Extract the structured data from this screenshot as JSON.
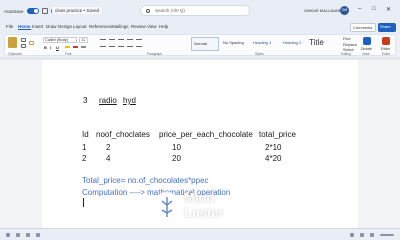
{
  "window": {
    "autosave_label": "AutoSave",
    "autosave_state": "on",
    "file_name": "class practice • Saved",
    "search_placeholder": "Search (Alt+Q)",
    "user_name": "OMKAR MALLAVARU",
    "user_initials": "OM",
    "accent_color": "#1f5fbf"
  },
  "menu": {
    "tabs": [
      "File",
      "Home",
      "Insert",
      "Draw",
      "Design",
      "Layout",
      "References",
      "Mailings",
      "Review",
      "View",
      "Help"
    ],
    "active_tab": "Home",
    "comments_label": "Comments",
    "share_label": "Share"
  },
  "ribbon": {
    "font_name": "Calibri (Body)",
    "font_size": "11",
    "format_buttons": [
      "B",
      "I",
      "U"
    ],
    "styles": [
      "Normal",
      "No Spacing",
      "Heading 1",
      "Heading 2",
      "Title"
    ],
    "find_label": "Find",
    "replace_label": "Replace",
    "select_label": "Select",
    "dictate_label": "Dictate",
    "editor_label": "Editor",
    "groups": [
      "Clipboard",
      "Font",
      "Paragraph",
      "Styles",
      "Editing",
      "Voice",
      "Editor"
    ]
  },
  "document": {
    "line1": [
      "3",
      "radio",
      "hyd"
    ],
    "table_headers": [
      "Id",
      "noof_choclates",
      "price_per_each_chocolate",
      "total_price"
    ],
    "rows": [
      [
        "1",
        "2",
        "10",
        "2*10"
      ],
      [
        "2",
        "4",
        "20",
        "4*20"
      ]
    ],
    "formula": "Total_price= no.of_chocolates*ppec",
    "computation": "Computation ----> mathematical operation"
  },
  "watermark": {
    "line1": "Mind",
    "line2": "Luster"
  }
}
